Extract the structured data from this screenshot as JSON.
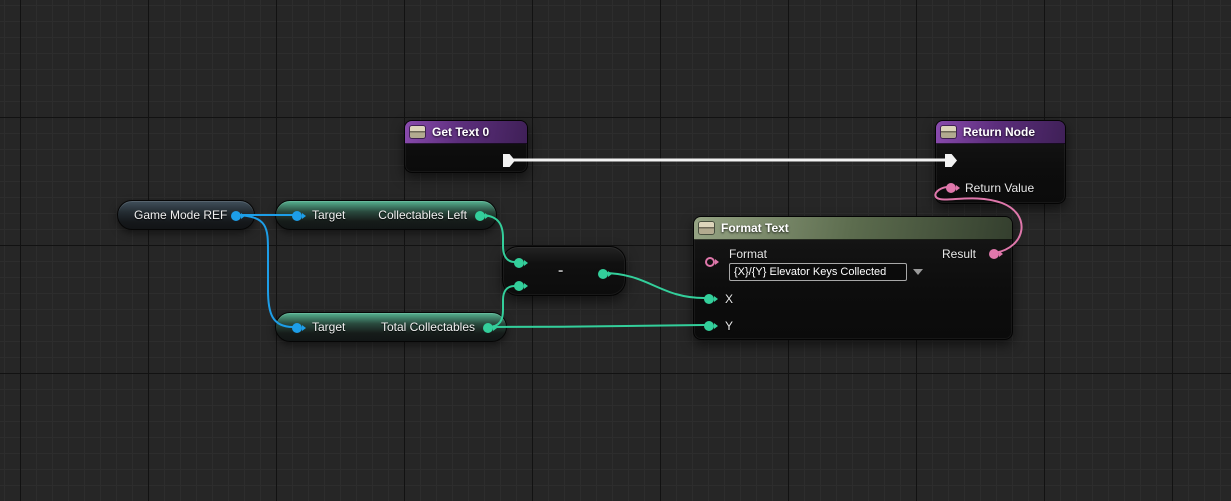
{
  "colors": {
    "exec": "#f2f2f2",
    "object": "#1d9ee8",
    "integer": "#33cf9b",
    "text": "#df77ab",
    "function_header": "#8a4bae",
    "text_header": "#96a484",
    "pill_green": "#56b492",
    "pill_blue": "#41505c"
  },
  "nodes": {
    "get_text": {
      "title": "Get Text 0"
    },
    "return_node": {
      "title": "Return Node",
      "return_value_label": "Return Value"
    },
    "game_mode_ref": {
      "label": "Game Mode REF"
    },
    "collectables_left": {
      "target_label": "Target",
      "label": "Collectables Left"
    },
    "total_collectables": {
      "target_label": "Target",
      "label": "Total Collectables"
    },
    "subtract": {
      "operator": "-"
    },
    "format_text": {
      "title": "Format Text",
      "format_label": "Format",
      "format_value": "{X}/{Y} Elevator Keys Collected",
      "x_label": "X",
      "y_label": "Y",
      "result_label": "Result"
    }
  }
}
